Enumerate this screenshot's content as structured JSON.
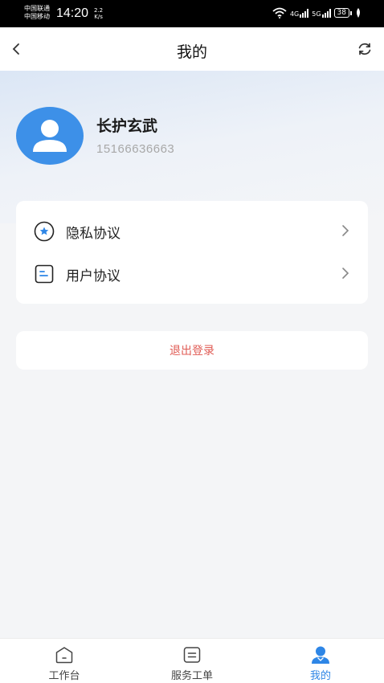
{
  "status_bar": {
    "carrier1": "中国联通",
    "carrier2": "中国移动",
    "time": "14:20",
    "net_speed_value": "2.2",
    "net_speed_unit": "K/s",
    "signal1": "4G",
    "signal2": "5G",
    "battery": "38"
  },
  "header": {
    "title": "我的"
  },
  "profile": {
    "name": "长护玄武",
    "phone": "15166636663"
  },
  "menu": {
    "items": [
      {
        "label": "隐私协议",
        "icon": "privacy-icon"
      },
      {
        "label": "用户协议",
        "icon": "document-icon"
      }
    ]
  },
  "logout": {
    "label": "退出登录"
  },
  "tabbar": {
    "tabs": [
      {
        "label": "工作台",
        "icon": "workbench-icon"
      },
      {
        "label": "服务工单",
        "icon": "work-order-icon"
      },
      {
        "label": "我的",
        "icon": "profile-icon"
      }
    ],
    "active": "我的"
  },
  "colors": {
    "accent": "#2e86e6",
    "avatar": "#3d90e8",
    "danger": "#e05c55",
    "background": "#f4f5f7"
  }
}
